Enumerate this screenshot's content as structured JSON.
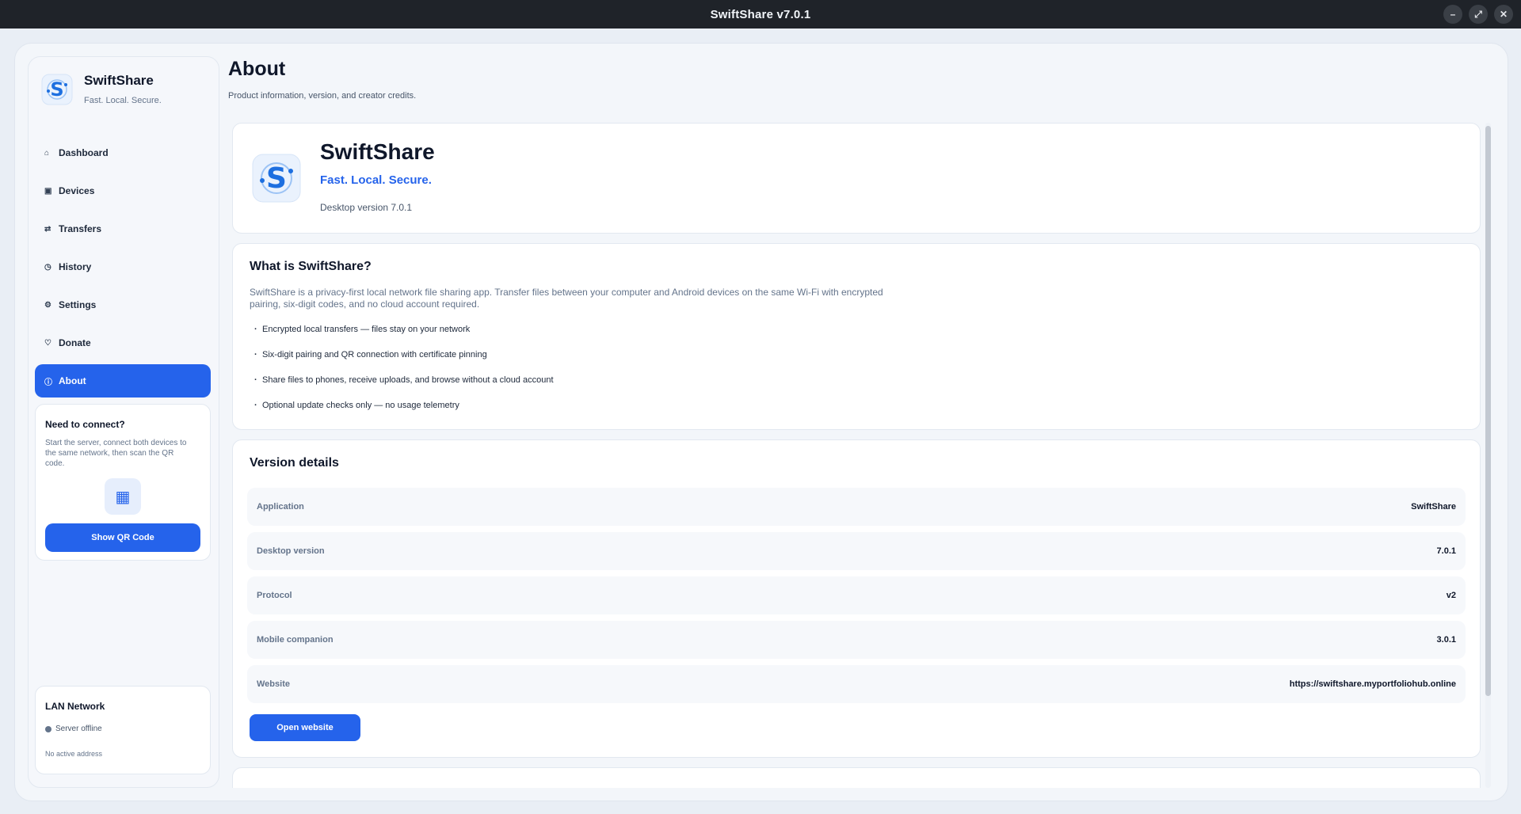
{
  "window": {
    "title": "SwiftShare v7.0.1",
    "controls": [
      "–",
      "⤢",
      "✕"
    ]
  },
  "sidebar": {
    "brand_name": "SwiftShare",
    "brand_tagline": "Fast. Local. Secure.",
    "items": [
      {
        "label": "Dashboard",
        "icon": "home-icon",
        "glyph": "⌂"
      },
      {
        "label": "Devices",
        "icon": "device-icon",
        "glyph": "▣"
      },
      {
        "label": "Transfers",
        "icon": "transfer-icon",
        "glyph": "⇄"
      },
      {
        "label": "History",
        "icon": "clock-icon",
        "glyph": "◷"
      },
      {
        "label": "Settings",
        "icon": "gear-icon",
        "glyph": "⚙"
      },
      {
        "label": "Donate",
        "icon": "heart-icon",
        "glyph": "♡"
      },
      {
        "label": "About",
        "icon": "info-icon",
        "glyph": "ⓘ",
        "active": true
      }
    ],
    "connect": {
      "title": "Need to connect?",
      "text": "Start the server, connect both devices to the same network, then scan the QR code.",
      "qr_glyph": "▦",
      "button": "Show QR Code"
    },
    "lan": {
      "title": "LAN Network",
      "status": "Server offline",
      "address": "No active address"
    }
  },
  "main": {
    "title": "About",
    "subtitle": "Product information, version, and creator credits.",
    "hero": {
      "name": "SwiftShare",
      "tagline": "Fast. Local. Secure.",
      "version": "Desktop version 7.0.1"
    },
    "what": {
      "heading": "What is SwiftShare?",
      "text": "SwiftShare is a privacy-first local network file sharing app. Transfer files between your computer and Android devices on the same Wi-Fi with encrypted pairing, six-digit codes, and no cloud account required.",
      "bullets": [
        "Encrypted local transfers — files stay on your network",
        "Six-digit pairing and QR connection with certificate pinning",
        "Share files to phones, receive uploads, and browse without a cloud account",
        "Optional update checks only — no usage telemetry"
      ]
    },
    "version_details": {
      "heading": "Version details",
      "rows": [
        {
          "key": "Application",
          "value": "SwiftShare"
        },
        {
          "key": "Desktop version",
          "value": "7.0.1"
        },
        {
          "key": "Protocol",
          "value": "v2"
        },
        {
          "key": "Mobile companion",
          "value": "3.0.1"
        },
        {
          "key": "Website",
          "value": "https://swiftshare.myportfoliohub.online"
        }
      ],
      "button": "Open website"
    }
  },
  "colors": {
    "accent": "#2563eb",
    "titlebar": "#1f2329",
    "background": "#f3f6fa"
  }
}
